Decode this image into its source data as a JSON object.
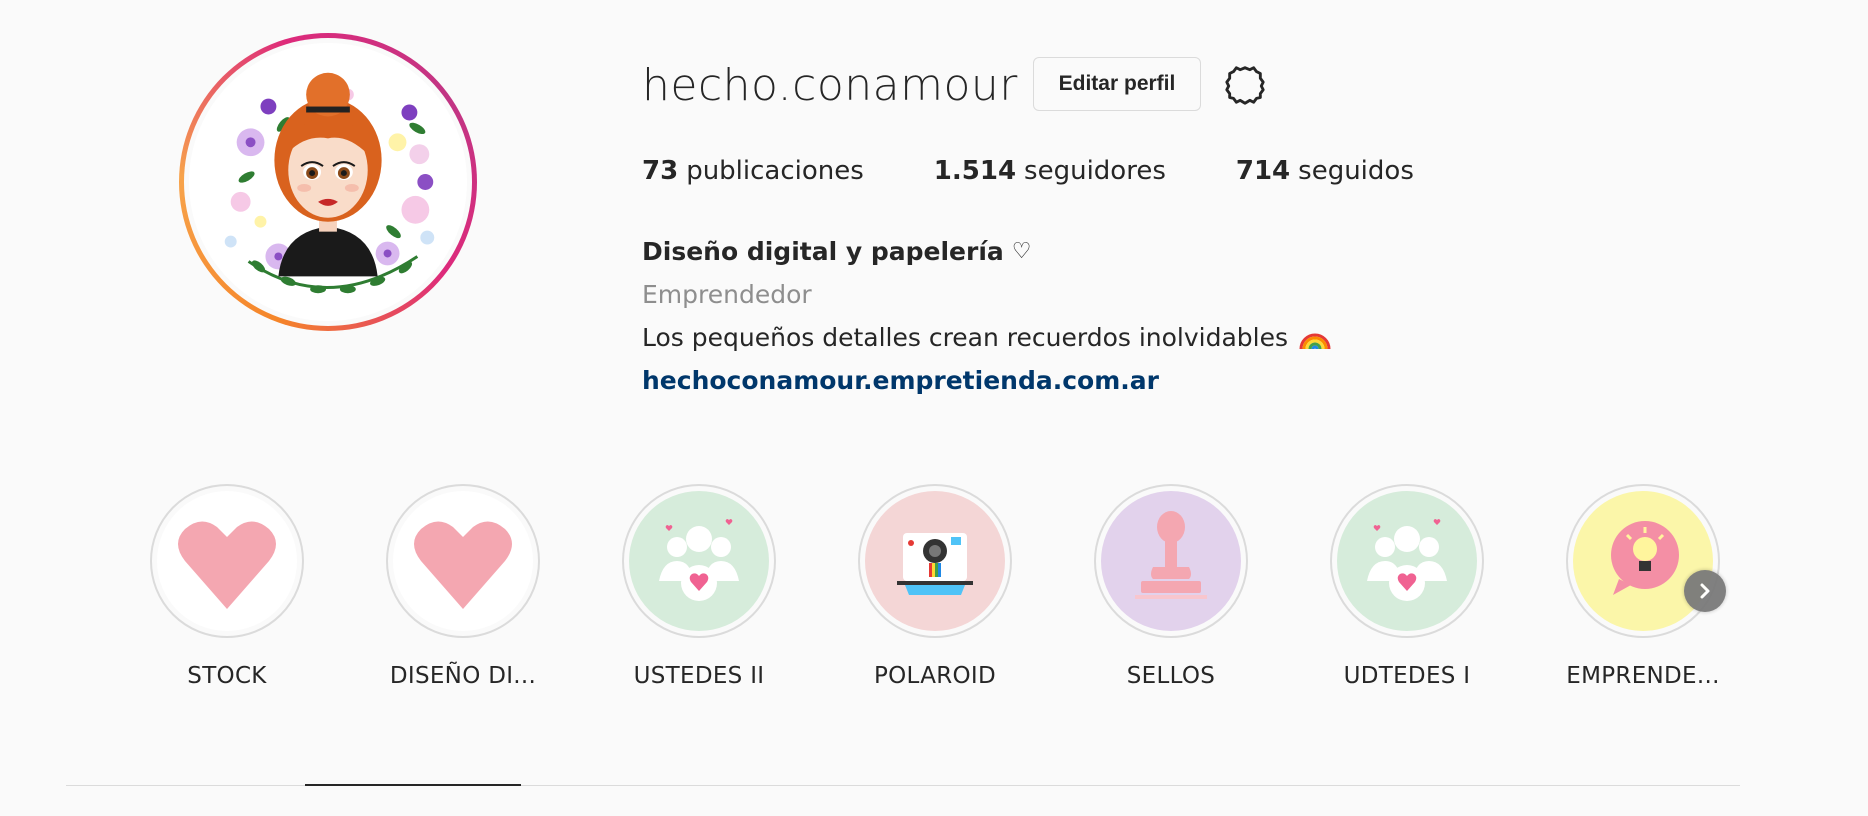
{
  "profile": {
    "username": "hecho.conamour",
    "edit_label": "Editar perfil",
    "settings_icon": "settings-gear-icon",
    "avatar_icon": "illustrated-profile-avatar"
  },
  "stats": {
    "posts_count": "73",
    "posts_label": "publicaciones",
    "followers_count": "1.514",
    "followers_label": "seguidores",
    "following_count": "714",
    "following_label": "seguidos"
  },
  "bio": {
    "name": "Diseño digital y papelería",
    "name_symbol": "♡",
    "category": "Emprendedor",
    "text": "Los pequeños detalles crean recuerdos inolvidables",
    "emoji_icon": "rainbow-icon",
    "link": "hechoconamour.empretienda.com.ar"
  },
  "highlights": [
    {
      "label": "STOCK",
      "icon": "pink-heart-icon",
      "bg": "#ffffff"
    },
    {
      "label": "DISEÑO DI...",
      "icon": "pink-heart-icon",
      "bg": "#ffffff"
    },
    {
      "label": "USTEDES II",
      "icon": "community-heart-icon",
      "bg": "#d6ecdb"
    },
    {
      "label": "POLAROID",
      "icon": "polaroid-camera-icon",
      "bg": "#f4d6d6"
    },
    {
      "label": "SELLOS",
      "icon": "stamp-icon",
      "bg": "#e2d2ec"
    },
    {
      "label": "UDTEDES I",
      "icon": "community-heart-icon",
      "bg": "#d6ecdb"
    },
    {
      "label": "EMPRENDE...",
      "icon": "lightbulb-bubble-icon",
      "bg": "#fbf6a9"
    }
  ],
  "colors": {
    "link": "#00376b",
    "ring_gradient_start": "#f58529",
    "ring_gradient_end": "#dd2a7b",
    "heart_pink": "#f4a7b1"
  }
}
